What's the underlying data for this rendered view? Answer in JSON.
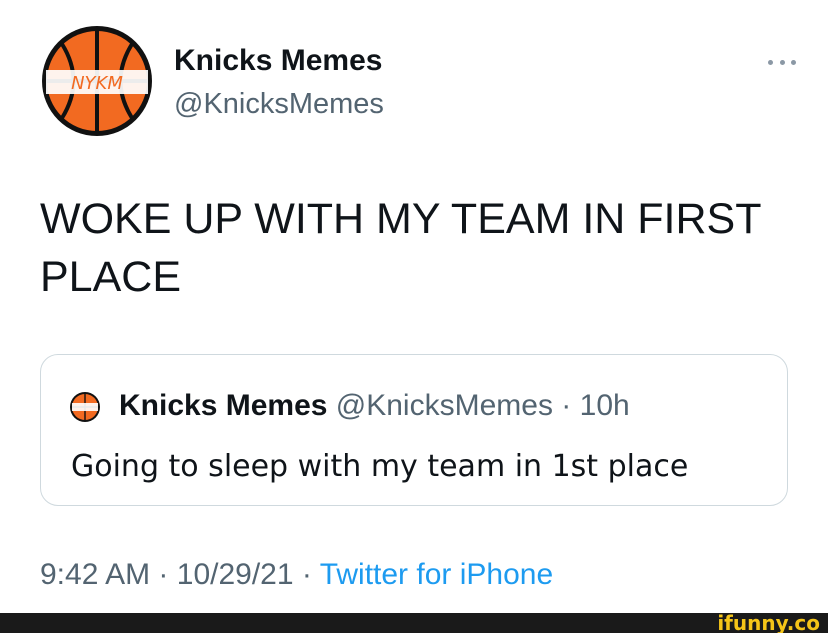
{
  "author": {
    "display_name": "Knicks Memes",
    "handle": "@KnicksMemes",
    "avatar_text": "NYKM"
  },
  "more_icon": "more-horizontal-icon",
  "tweet": {
    "text": "WOKE UP WITH MY TEAM IN FIRST PLACE"
  },
  "quoted_tweet": {
    "display_name": "Knicks Memes",
    "handle": "@KnicksMemes",
    "separator": "·",
    "time": "10h",
    "text": "Going to sleep with my team in 1st place"
  },
  "meta": {
    "time": "9:42 AM",
    "sep1": "·",
    "date": "10/29/21",
    "sep2": "·",
    "source": "Twitter for iPhone"
  },
  "watermark": "ifunny.co",
  "colors": {
    "text": "#0f1419",
    "secondary": "#536471",
    "link": "#1d9bf0",
    "basketball": "#f26a21",
    "border": "#cfd9de"
  }
}
